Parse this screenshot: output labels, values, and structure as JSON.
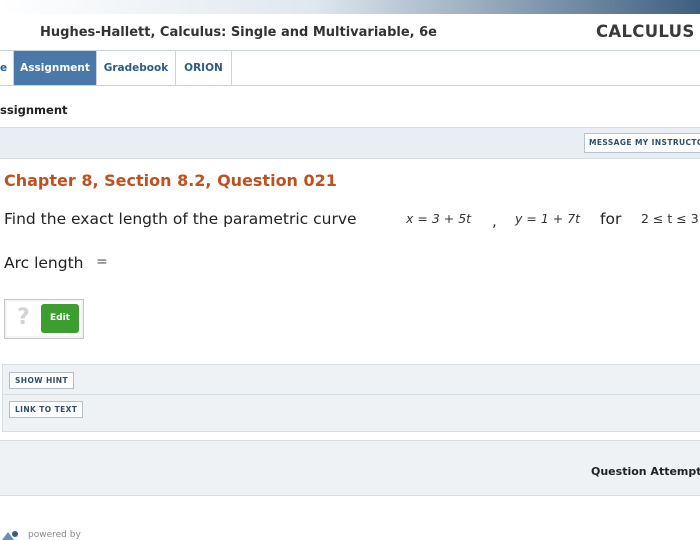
{
  "header": {
    "book_title": "Hughes-Hallett, Calculus: Single and Multivariable, 6e",
    "brand": "CALCULUS"
  },
  "tabs": [
    {
      "label": "e",
      "active": false
    },
    {
      "label": "Assignment",
      "active": true
    },
    {
      "label": "Gradebook",
      "active": false
    },
    {
      "label": "ORION",
      "active": false
    }
  ],
  "breadcrumb": "ssignment",
  "message_button": "MESSAGE MY INSTRUCTOR",
  "question": {
    "title": "Chapter 8, Section 8.2, Question 021",
    "prompt": "Find the exact length of the parametric curve",
    "x_eq": "x = 3 + 5t",
    "separator": ",",
    "y_eq": "y = 1 + 7t",
    "for_word": "for",
    "range": "2 ≤ t ≤ 3",
    "answer_label": "Arc length",
    "equals": "="
  },
  "answer": {
    "placeholder_icon": "question-mark-icon",
    "edit_label": "Edit"
  },
  "help": {
    "hint_button": "SHOW HINT",
    "link_button": "LINK TO TEXT"
  },
  "attempts_label": "Question Attempts",
  "footer": {
    "powered_by": "powered by"
  },
  "colors": {
    "accent_tab": "#4a78a8",
    "question_title": "#c0501f",
    "edit_button": "#3c9e2f",
    "panel_bg": "#eef2f5"
  }
}
